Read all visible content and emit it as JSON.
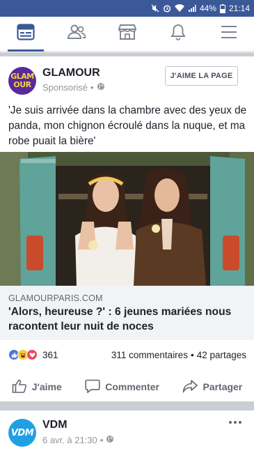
{
  "status_bar": {
    "battery_percent": "44%",
    "time": "21:14",
    "icons": [
      "mute-icon",
      "alarm-icon",
      "wifi-icon",
      "signal-icon",
      "battery-icon"
    ]
  },
  "nav": {
    "tabs": [
      "news-feed-icon",
      "friends-icon",
      "marketplace-icon",
      "notifications-icon",
      "menu-icon"
    ],
    "active_tab": "news-feed-icon",
    "accent_color": "#3b5998"
  },
  "post1": {
    "page_name": "GLAMOUR",
    "avatar_text_top": "GLAM",
    "avatar_text_bottom": "OUR",
    "sponsored": "Sponsorisé",
    "like_page_button": "J'AIME LA PAGE",
    "text": "'Je suis arrivée dans la chambre avec des yeux de panda, mon chignon écroulé dans la nuque, et ma robe puait la bière'",
    "link_domain": "GLAMOURPARIS.COM",
    "link_title": "'Alors, heureuse ?' : 6 jeunes mariées nous racontent leur nuit de noces",
    "reaction_count": "361",
    "reaction_types": [
      "like",
      "haha",
      "love"
    ],
    "comments": "311 commentaires",
    "shares": "42 partages",
    "separator": "•",
    "actions": {
      "like": "J'aime",
      "comment": "Commenter",
      "share": "Partager"
    }
  },
  "post2": {
    "page_name": "VDM",
    "avatar_text": "VDM",
    "date": "6 avr. à 21:30"
  }
}
